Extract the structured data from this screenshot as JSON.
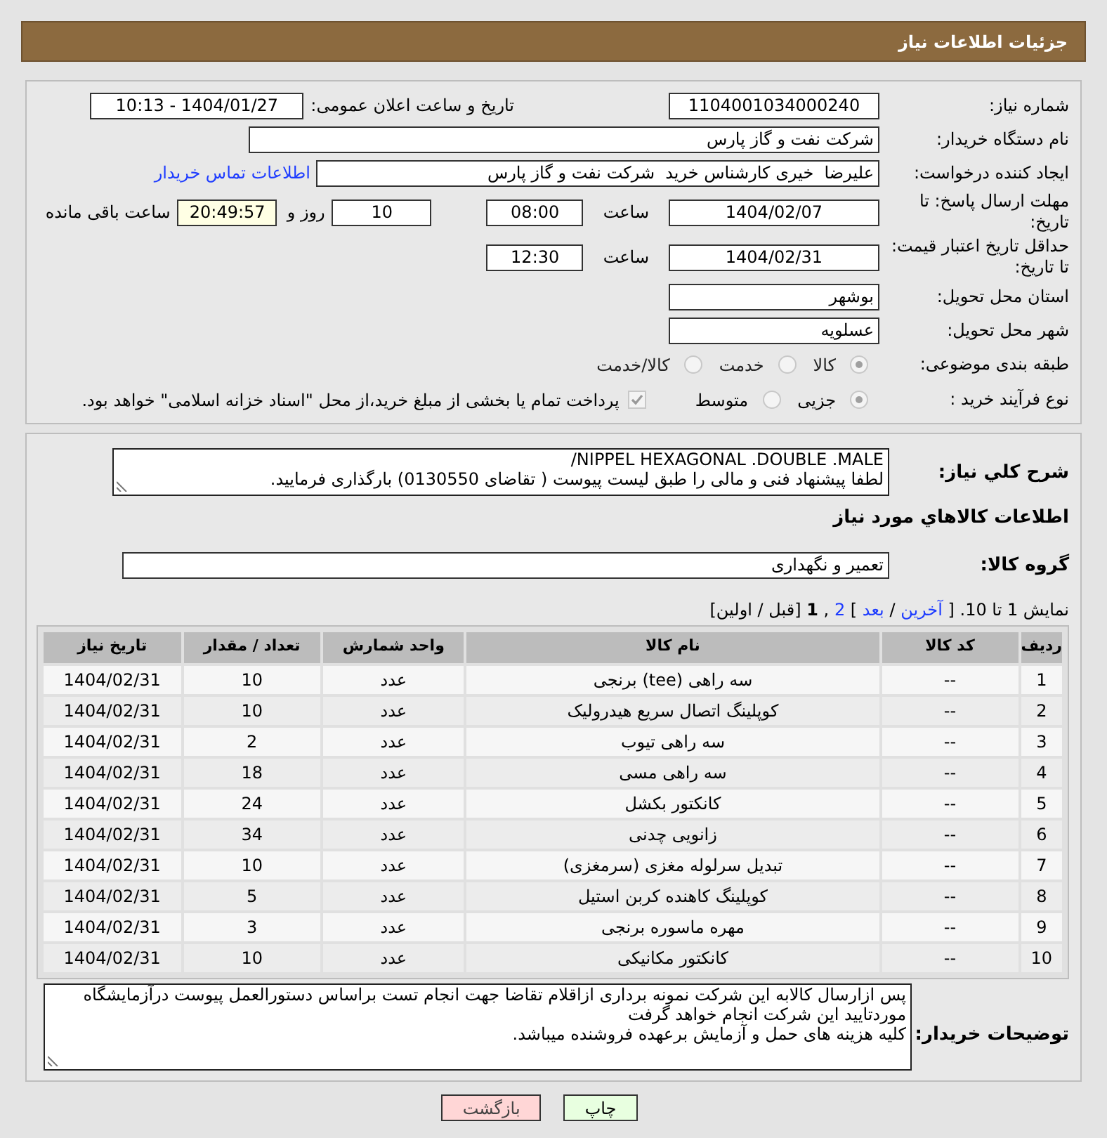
{
  "header": {
    "title": "جزئیات اطلاعات نیاز"
  },
  "need_number": {
    "label": "شماره نیاز:",
    "value": "1104001034000240"
  },
  "announce": {
    "label": "تاریخ و ساعت اعلان عمومی:",
    "value": "1404/01/27 - 10:13"
  },
  "buyer_org": {
    "label": "نام دستگاه خریدار:",
    "value": "شرکت نفت و گاز پارس"
  },
  "requester": {
    "label": "ایجاد کننده درخواست:",
    "value": "علیرضا  خیری کارشناس خرید  شرکت نفت و گاز پارس",
    "link": "اطلاعات تماس خریدار"
  },
  "deadline": {
    "label": "مهلت ارسال پاسخ: تا تاریخ:",
    "date": "1404/02/07",
    "time_label": "ساعت",
    "time": "08:00",
    "days": "10",
    "days_label": "روز و",
    "remaining": "20:49:57",
    "remaining_label": "ساعت باقی مانده"
  },
  "validity": {
    "label": "حداقل تاریخ اعتبار قیمت: تا تاریخ:",
    "date": "1404/02/31",
    "time_label": "ساعت",
    "time": "12:30"
  },
  "province": {
    "label": "استان محل تحویل:",
    "value": "بوشهر"
  },
  "city": {
    "label": "شهر محل تحویل:",
    "value": "عسلویه"
  },
  "category": {
    "label": "طبقه بندی موضوعی:",
    "options": [
      {
        "label": "کالا",
        "selected": true
      },
      {
        "label": "خدمت",
        "selected": false
      },
      {
        "label": "کالا/خدمت",
        "selected": false
      }
    ]
  },
  "process": {
    "label": "نوع فرآیند خرید :",
    "options": [
      {
        "label": "جزیی",
        "selected": true
      },
      {
        "label": "متوسط",
        "selected": false
      }
    ],
    "payment_note": {
      "checked": true,
      "text": "پرداخت تمام یا بخشی از مبلغ خرید،از محل \"اسناد خزانه اسلامی\" خواهد بود."
    }
  },
  "description": {
    "label": "شرح كلي نياز:",
    "lines": [
      "NIPPEL HEXAGONAL .DOUBLE .MALE/",
      "لطفا پیشنهاد فنی و مالی را طبق لیست پیوست ( تقاضای 0130550) بارگذاری فرمایید."
    ]
  },
  "goods_heading": "اطلاعات كالاهاي مورد نياز",
  "goods_group": {
    "label": "گروه کالا:",
    "value": "تعمیر و نگهداری"
  },
  "pagination": [
    {
      "kind": "text",
      "text": "نمایش 1 تا 10. ["
    },
    {
      "kind": "link",
      "text": "آخرین"
    },
    {
      "kind": "text",
      "text": "/"
    },
    {
      "kind": "link",
      "text": "بعد"
    },
    {
      "kind": "text",
      "text": "]"
    },
    {
      "kind": "link",
      "text": "2"
    },
    {
      "kind": "text",
      "text": ","
    },
    {
      "kind": "current",
      "text": "1"
    },
    {
      "kind": "text",
      "text": "[قبل / اولین]"
    }
  ],
  "table": {
    "columns": [
      "ردیف",
      "کد کالا",
      "نام کالا",
      "واحد شمارش",
      "تعداد / مقدار",
      "تاریخ نیاز"
    ],
    "rows": [
      [
        "1",
        "--",
        "سه راهی (tee) برنجی",
        "عدد",
        "10",
        "1404/02/31"
      ],
      [
        "2",
        "--",
        "کوپلینگ اتصال سریع هیدرولیک",
        "عدد",
        "10",
        "1404/02/31"
      ],
      [
        "3",
        "--",
        "سه راهی تیوب",
        "عدد",
        "2",
        "1404/02/31"
      ],
      [
        "4",
        "--",
        "سه راهی مسی",
        "عدد",
        "18",
        "1404/02/31"
      ],
      [
        "5",
        "--",
        "کانکتور بکشل",
        "عدد",
        "24",
        "1404/02/31"
      ],
      [
        "6",
        "--",
        "زانویی چدنی",
        "عدد",
        "34",
        "1404/02/31"
      ],
      [
        "7",
        "--",
        "تبدیل سرلوله مغزی (سرمغزی)",
        "عدد",
        "10",
        "1404/02/31"
      ],
      [
        "8",
        "--",
        "کوپلینگ کاهنده کربن استیل",
        "عدد",
        "5",
        "1404/02/31"
      ],
      [
        "9",
        "--",
        "مهره ماسوره برنجی",
        "عدد",
        "3",
        "1404/02/31"
      ],
      [
        "10",
        "--",
        "کانکتور مکانیکی",
        "عدد",
        "10",
        "1404/02/31"
      ]
    ]
  },
  "buyer_notes": {
    "label": "توضیحات خریدار:",
    "lines": [
      "پس ازارسال کالابه این شرکت نمونه برداری ازاقلام تقاضا جهت انجام تست براساس دستورالعمل پیوست درآزمایشگاه",
      "موردتایید این شرکت انجام خواهد گرفت",
      "کلیه هزینه های حمل و آزمایش برعهده فروشنده میباشد."
    ]
  },
  "buttons": [
    {
      "kind": "print",
      "label": "چاپ"
    },
    {
      "kind": "back",
      "label": "بازگشت"
    }
  ]
}
